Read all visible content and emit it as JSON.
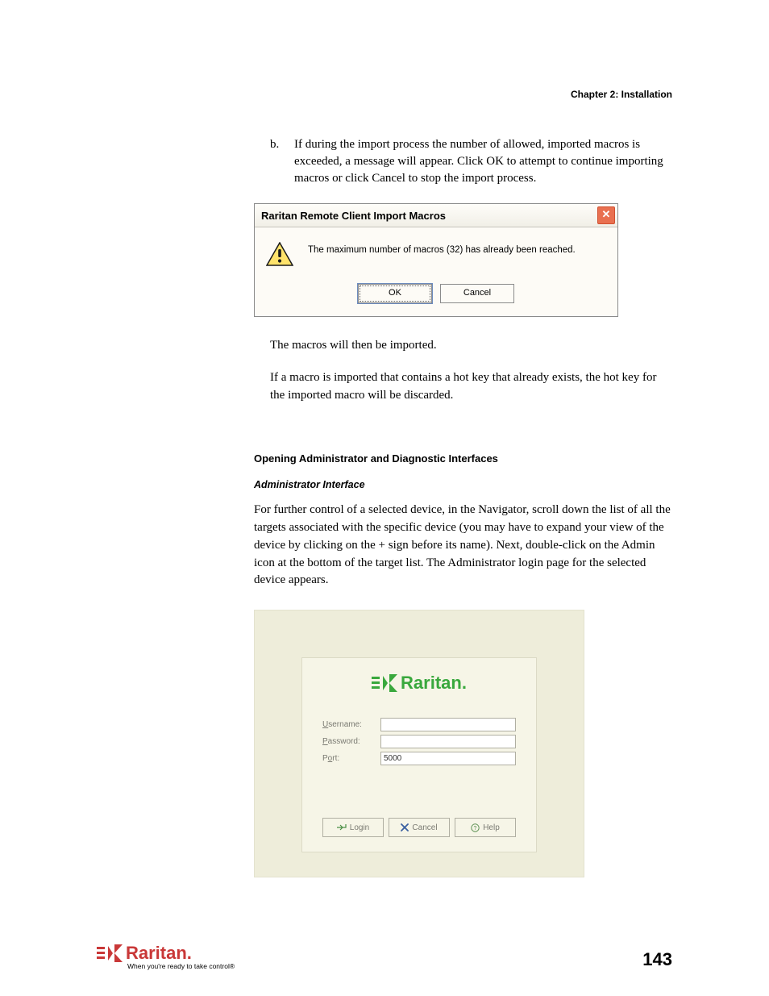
{
  "chapter_header": "Chapter 2: Installation",
  "list_b_marker": "b.",
  "list_b_text": "If during the import process the number of allowed, imported macros is exceeded, a message will appear.  Click OK to attempt to continue importing macros or click Cancel to stop the import process.",
  "dialog": {
    "title": "Raritan Remote Client Import Macros",
    "close_label": "✕",
    "message": "The maximum number of macros (32) has already been reached.",
    "ok": "OK",
    "cancel": "Cancel"
  },
  "post_dialog_para1": "The macros will then be imported.",
  "post_dialog_para2": "If a macro is imported that contains a hot key that already exists, the hot key for the imported macro will be discarded.",
  "section_heading": "Opening Administrator and Diagnostic Interfaces",
  "subsection_heading": "Administrator Interface",
  "admin_para": "For further control of a selected device, in the Navigator, scroll down the list of all the targets associated with the specific device (you may have to expand your view of the device by clicking on the + sign before its name). Next, double-click on the Admin icon at the bottom of the target list. The Administrator login page for the selected device appears.",
  "login": {
    "brand": "Raritan.",
    "username_label_pre": "U",
    "username_label_rest": "sername:",
    "password_label_pre": "P",
    "password_label_rest": "assword:",
    "port_label_pre": "o",
    "port_label_prefix": "P",
    "port_label_rest": "rt:",
    "username_val": "",
    "password_val": "",
    "port_val": "5000",
    "login_btn": "Login",
    "cancel_btn": "Cancel",
    "help_btn": "Help"
  },
  "footer": {
    "brand": "Raritan.",
    "tagline": "When you're ready to take control®",
    "page_number": "143"
  }
}
